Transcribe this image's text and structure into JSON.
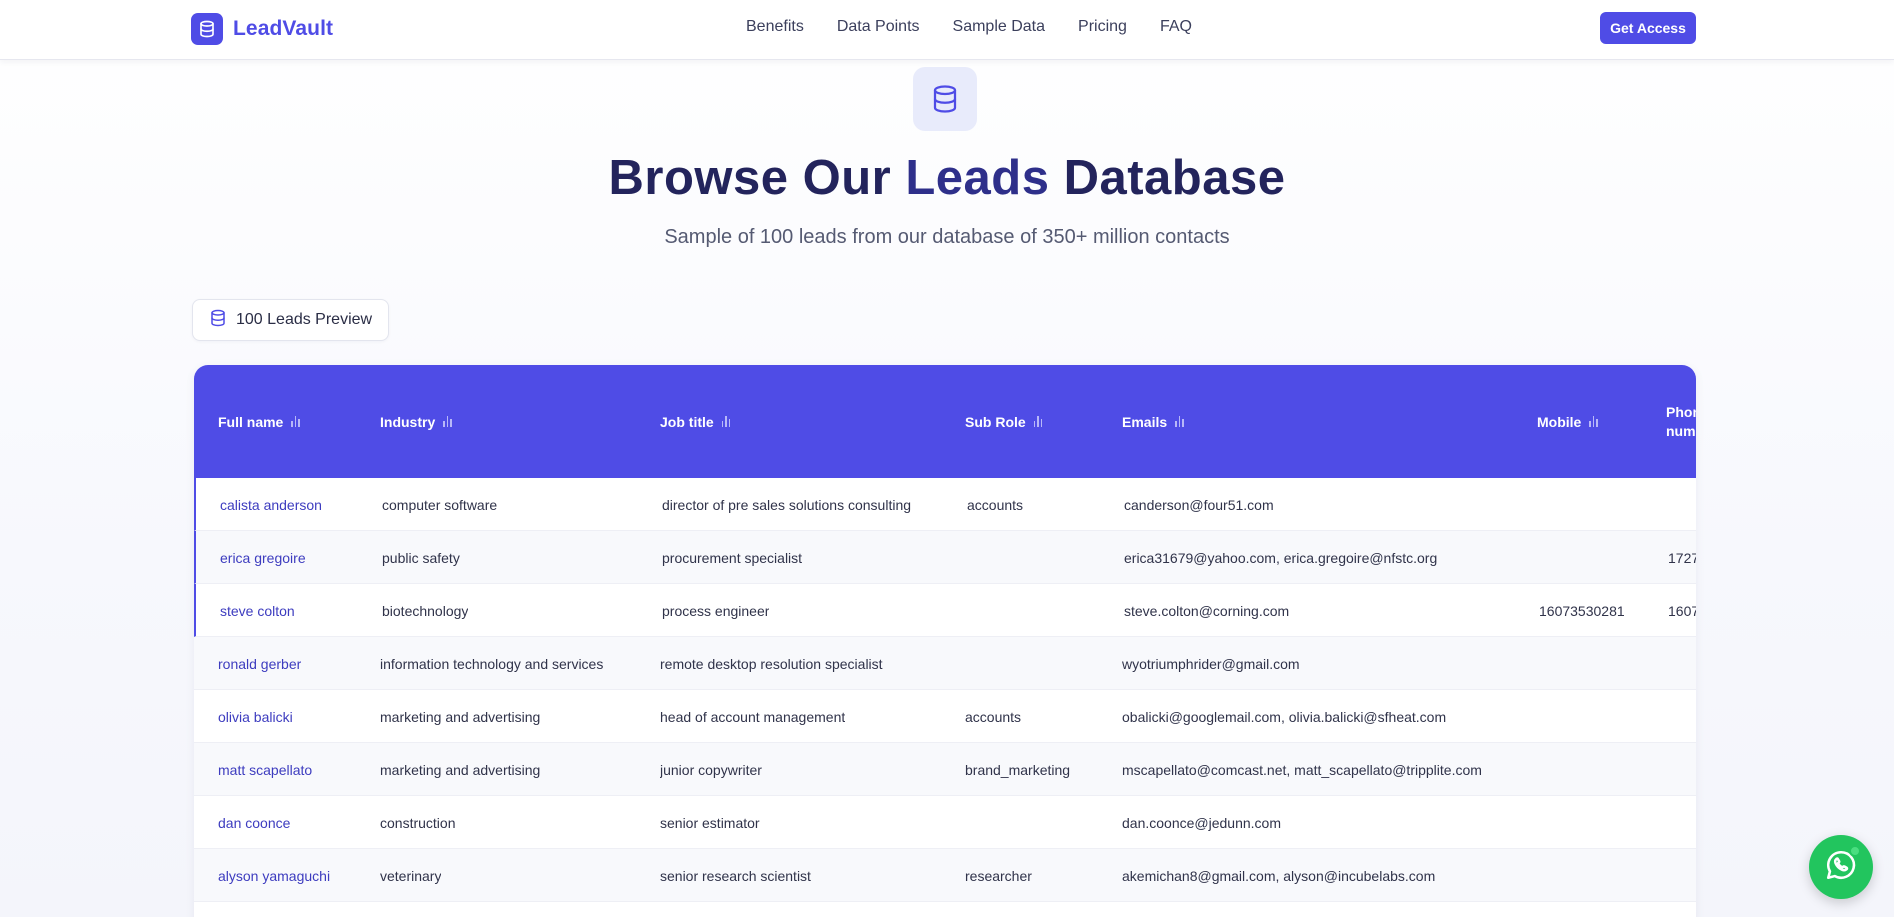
{
  "brand": {
    "name": "LeadVault",
    "icon": "database-icon"
  },
  "nav": {
    "links": [
      "Benefits",
      "Data Points",
      "Sample Data",
      "Pricing",
      "FAQ"
    ],
    "cta_label": "Get Access"
  },
  "hero": {
    "icon": "database-icon",
    "title_part1": "Browse Our ",
    "title_part2": "Leads",
    "title_part3": " Database",
    "subtitle": "Sample of 100 leads from our database of 350+ million contacts"
  },
  "preview_badge": {
    "label": "100 Leads Preview",
    "icon": "database-icon"
  },
  "table": {
    "columns": [
      "Full name",
      "Industry",
      "Job title",
      "Sub Role",
      "Emails",
      "Mobile",
      "Phone number"
    ],
    "rows": [
      [
        "calista anderson",
        "computer software",
        "director of pre sales solutions consulting",
        "accounts",
        "canderson@four51.com",
        "",
        ""
      ],
      [
        "erica gregoire",
        "public safety",
        "procurement specialist",
        "",
        "erica31679@yahoo.com, erica.gregoire@nfstc.org",
        "",
        "1727"
      ],
      [
        "steve colton",
        "biotechnology",
        "process engineer",
        "",
        "steve.colton@corning.com",
        "16073530281",
        "1607"
      ],
      [
        "ronald gerber",
        "information technology and services",
        "remote desktop resolution specialist",
        "",
        "wyotriumphrider@gmail.com",
        "",
        ""
      ],
      [
        "olivia balicki",
        "marketing and advertising",
        "head of account management",
        "accounts",
        "obalicki@googlemail.com, olivia.balicki@sfheat.com",
        "",
        ""
      ],
      [
        "matt scapellato",
        "marketing and advertising",
        "junior copywriter",
        "brand_marketing",
        "mscapellato@comcast.net, matt_scapellato@tripplite.com",
        "",
        ""
      ],
      [
        "dan coonce",
        "construction",
        "senior estimator",
        "",
        "dan.coonce@jedunn.com",
        "",
        ""
      ],
      [
        "alyson yamaguchi",
        "veterinary",
        "senior research scientist",
        "researcher",
        "akemichan8@gmail.com, alyson@incubelabs.com",
        "",
        ""
      ]
    ]
  },
  "colors": {
    "accent": "#4f4ce6",
    "title": "#23245c",
    "whatsapp": "#22c55e"
  }
}
